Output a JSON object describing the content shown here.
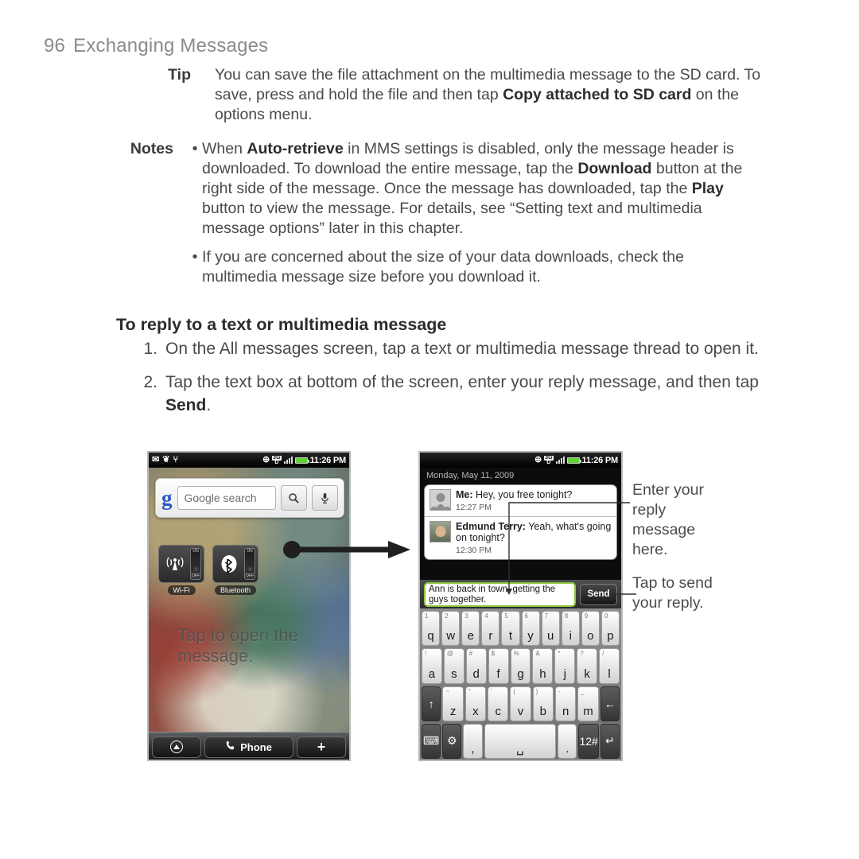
{
  "running_head": {
    "page_number": "96",
    "title": "Exchanging Messages"
  },
  "tip": {
    "label": "Tip",
    "parts": [
      {
        "t": "You can save the file attachment on the multimedia message to the SD card. To save, press and hold the file and then tap ",
        "b": false
      },
      {
        "t": "Copy attached to SD card",
        "b": true
      },
      {
        "t": " on the options menu.",
        "b": false
      }
    ]
  },
  "notes": {
    "label": "Notes",
    "bullet": "•",
    "items": [
      [
        {
          "t": "When ",
          "b": false
        },
        {
          "t": "Auto-retrieve",
          "b": true
        },
        {
          "t": " in MMS settings is disabled, only the message header is downloaded. To download the entire message, tap the ",
          "b": false
        },
        {
          "t": "Download",
          "b": true
        },
        {
          "t": " button at the right side of the message. Once the message has downloaded, tap the ",
          "b": false
        },
        {
          "t": "Play",
          "b": true
        },
        {
          "t": " button to view the message. For details, see “Setting text and multimedia message options” later in this chapter.",
          "b": false
        }
      ],
      [
        {
          "t": "If you are concerned about the size of your data downloads, check the multimedia message size before you download it.",
          "b": false
        }
      ]
    ]
  },
  "section_heading": "To reply to a text or multimedia message",
  "steps": [
    {
      "number": "1.",
      "parts": [
        {
          "t": "On the All messages screen, tap a text or multimedia message thread to open it.",
          "b": false
        }
      ]
    },
    {
      "number": "2.",
      "parts": [
        {
          "t": "Tap the text box at bottom of the screen, enter your reply message, and then tap ",
          "b": false
        },
        {
          "t": "Send",
          "b": true
        },
        {
          "t": ".",
          "b": false
        }
      ]
    }
  ],
  "phone_left": {
    "status_bar": {
      "icons_left": [
        "envelope-icon",
        "bird-icon",
        "usb-icon"
      ],
      "envelope": "✉",
      "bird": "❦",
      "usb": "⑂",
      "gps": "⊕",
      "network_label": "3G",
      "network_sub": "D",
      "time": "11:26 PM"
    },
    "search_widget": {
      "logo": "g",
      "placeholder": "Google search",
      "search_icon": "⚲",
      "mic_icon": "☸"
    },
    "toggles": [
      {
        "name": "Wi-Fi",
        "on_label": "ON",
        "off_label": "OFF",
        "glyph": "ᴧ"
      },
      {
        "name": "Bluetooth",
        "on_label": "ON",
        "off_label": "OFF",
        "glyph": "ᛦ"
      }
    ],
    "wallpaper_note": "Tap to open the message.",
    "dock": {
      "apps_label": "▲",
      "phone_label": "Phone",
      "phone_icon": "✆",
      "add_label": "+"
    }
  },
  "phone_right": {
    "status_bar": {
      "gps": "⊕",
      "network_label": "3G",
      "network_sub": "D",
      "time": "11:26 PM"
    },
    "date_header": "Monday, May 11, 2009",
    "messages": [
      {
        "sender": "Me:",
        "text": " Hey, you free tonight?",
        "time": "12:27 PM",
        "avatar": "generic-person-avatar"
      },
      {
        "sender": "Edmund Terry:",
        "text": " Yeah, what's going on tonight?",
        "time": "12:30 PM",
        "avatar": "photo-avatar"
      }
    ],
    "reply_text": "Ann is back in town, getting the guys together.",
    "send_label": "Send",
    "keyboard": {
      "row1": [
        {
          "k": "q",
          "n": "1"
        },
        {
          "k": "w",
          "n": "2"
        },
        {
          "k": "e",
          "n": "3"
        },
        {
          "k": "r",
          "n": "4"
        },
        {
          "k": "t",
          "n": "5"
        },
        {
          "k": "y",
          "n": "6"
        },
        {
          "k": "u",
          "n": "7"
        },
        {
          "k": "i",
          "n": "8"
        },
        {
          "k": "o",
          "n": "9"
        },
        {
          "k": "p",
          "n": "0"
        }
      ],
      "row2": [
        {
          "k": "a",
          "n": "!"
        },
        {
          "k": "s",
          "n": "@"
        },
        {
          "k": "d",
          "n": "#"
        },
        {
          "k": "f",
          "n": "$"
        },
        {
          "k": "g",
          "n": "%"
        },
        {
          "k": "h",
          "n": "&"
        },
        {
          "k": "j",
          "n": "*"
        },
        {
          "k": "k",
          "n": "?"
        },
        {
          "k": "l",
          "n": "/"
        }
      ],
      "row3": [
        {
          "k": "z",
          "n": "~"
        },
        {
          "k": "x",
          "n": "\""
        },
        {
          "k": "c",
          "n": "'"
        },
        {
          "k": "v",
          "n": "("
        },
        {
          "k": "b",
          "n": ")"
        },
        {
          "k": "n",
          "n": "-"
        },
        {
          "k": "m",
          "n": "_"
        }
      ],
      "shift": "↑",
      "backspace": "←",
      "keyboard_switch": "⌨",
      "settings": "⚙",
      "comma": ",",
      "space": "␣",
      "period": ".",
      "numsym": "12#",
      "enter": "↵"
    }
  },
  "callouts": {
    "enter_reply": "Enter your reply message here.",
    "tap_send": "Tap to send your reply."
  },
  "colors": {
    "accent_green": "#8dc63f",
    "body_text": "#4a4a4a",
    "heading": "#2b2b2b",
    "running_head": "#8b8b8b"
  }
}
